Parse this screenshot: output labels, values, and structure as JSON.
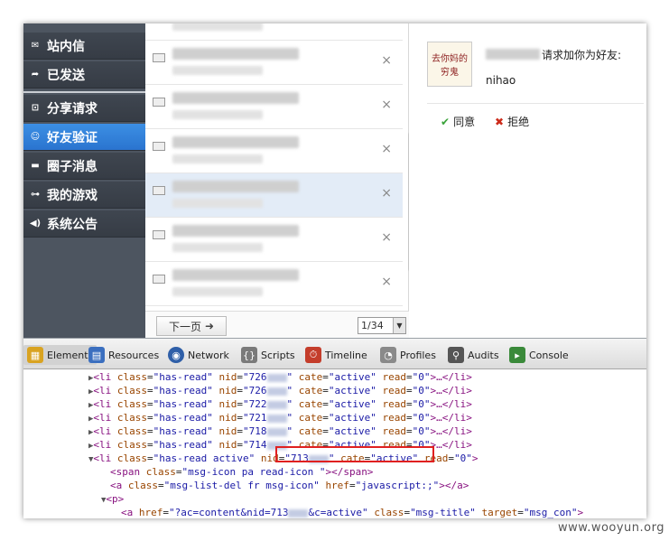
{
  "sidebar": {
    "items": [
      {
        "label": "站内信",
        "icon": "envelope-icon",
        "active": false
      },
      {
        "label": "已发送",
        "icon": "send-icon",
        "active": false
      },
      {
        "label": "分享请求",
        "icon": "share-icon",
        "active": false
      },
      {
        "label": "好友验证",
        "icon": "user-verify-icon",
        "active": true
      },
      {
        "label": "圈子消息",
        "icon": "chat-icon",
        "active": false
      },
      {
        "label": "我的游戏",
        "icon": "gamepad-icon",
        "active": false
      },
      {
        "label": "系统公告",
        "icon": "speaker-icon",
        "active": false
      }
    ]
  },
  "msglist": {
    "delete_glyph": "×",
    "pager": {
      "next_label": "下一页",
      "next_arrow": "➜",
      "page_value": "1/34"
    }
  },
  "detail": {
    "avatar_text_1": "去你妈的",
    "avatar_text_2": "穷鬼",
    "request_text": "请求加你为好友:",
    "request_message": "nihao",
    "agree_label": "同意",
    "reject_label": "拒绝"
  },
  "devtools": {
    "tabs": [
      {
        "label": "Elements",
        "icon": "elements-icon",
        "color": "#d9a321"
      },
      {
        "label": "Resources",
        "icon": "resources-icon",
        "color": "#3b6fbf"
      },
      {
        "label": "Network",
        "icon": "network-icon",
        "color": "#2f5fa8"
      },
      {
        "label": "Scripts",
        "icon": "scripts-icon",
        "color": "#7a7a7a"
      },
      {
        "label": "Timeline",
        "icon": "timeline-icon",
        "color": "#c43d2b"
      },
      {
        "label": "Profiles",
        "icon": "profiles-icon",
        "color": "#8a8a8a"
      },
      {
        "label": "Audits",
        "icon": "audits-icon",
        "color": "#555555"
      },
      {
        "label": "Console",
        "icon": "console-icon",
        "color": "#3a8a3a"
      }
    ],
    "li_open": "<li class=",
    "li_class_val": "\"has-read\"",
    "nid_prefix": " nid=\"726",
    "cate_part": "\" cate=\"active\" read=\"0\">…</li>",
    "rows_nid": [
      "726",
      "726",
      "722",
      "721",
      "718",
      "714"
    ],
    "active_li_prefix": "<li class=\"has-read active\"",
    "active_nid": " nid=\"713",
    "active_rest": "\" cate=\"active\" read=\"0\">",
    "span_line": "<span class=\"msg-icon pa read-icon \"></span>",
    "a_line": "<a class=\"msg-list-del fr msg-icon\" href=\"javascript:;\"></a>",
    "p_line": "<p>",
    "href_line_prefix": "<a href=\"?ac=content&nid=713",
    "href_line_rest": "&c=active\" class=\"msg-title\" target=\"msg_con\">"
  },
  "watermark": "www.wooyun.org",
  "colors": {
    "active_blue": "#2a74cf",
    "sidebar_bg": "#4d5560",
    "highlight_red": "#e02020"
  }
}
